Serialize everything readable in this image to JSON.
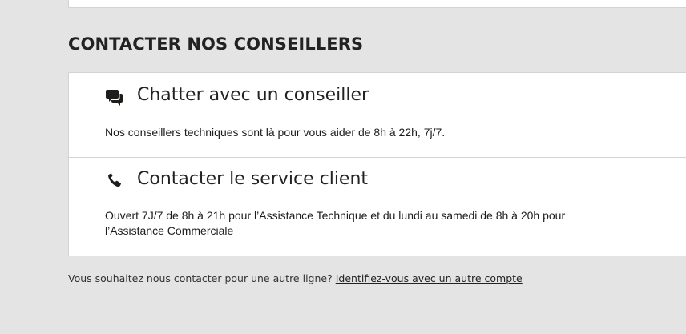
{
  "section_title": "CONTACTER NOS CONSEILLERS",
  "contacts": [
    {
      "icon": "chat-icon",
      "title": "Chatter avec un conseiller",
      "description": "Nos conseillers techniques sont là pour vous aider de 8h à 22h, 7j/7."
    },
    {
      "icon": "phone-icon",
      "title": "Contacter le service client",
      "description": "Ouvert 7J/7 de 8h à 21h pour l’Assistance Technique et du lundi au samedi de 8h à 20h pour l’Assistance Commerciale"
    }
  ],
  "footer": {
    "question": "Vous souhaitez nous contacter pour une autre ligne?",
    "link_label": "Identifiez-vous avec un autre compte"
  },
  "colors": {
    "background": "#e3e4e3",
    "card": "#ffffff",
    "border": "#d3d3d3",
    "text": "#1d1d1b"
  }
}
